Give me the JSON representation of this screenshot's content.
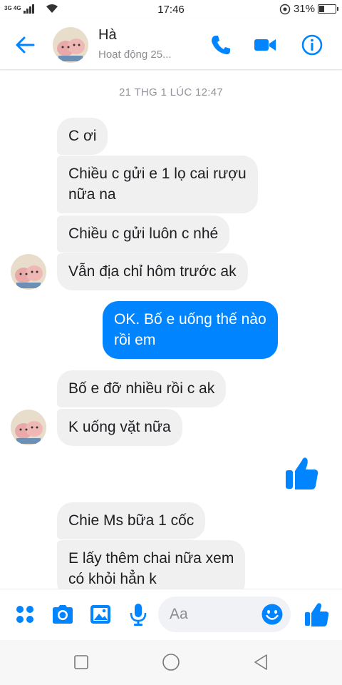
{
  "status_bar": {
    "network": "3G 4G",
    "time": "17:46",
    "battery": "31%",
    "battery_level": 0.31
  },
  "header": {
    "name": "Hà",
    "status": "Hoạt động 25...",
    "icons": [
      "back-arrow-icon",
      "phone-icon",
      "video-call-icon",
      "info-icon"
    ]
  },
  "chat": {
    "timestamp": "21 THG 1 LÚC 12:47",
    "messages": [
      {
        "from": "contact",
        "lines": [
          "C ơi"
        ]
      },
      {
        "from": "contact",
        "lines": [
          "Chiều c gửi e 1 lọ cai rượu",
          "nữa na"
        ]
      },
      {
        "from": "contact",
        "lines": [
          "Chiều c gửi luôn c nhé"
        ]
      },
      {
        "from": "contact",
        "lines": [
          "Vẫn địa chỉ hôm trước ak"
        ]
      },
      {
        "from": "me",
        "lines": [
          "OK. Bố e uống thế nào",
          "rồi em"
        ]
      },
      {
        "from": "contact",
        "lines": [
          "Bố e đỡ nhiều rồi c ak"
        ]
      },
      {
        "from": "contact",
        "lines": [
          "K uống vặt nữa"
        ]
      },
      {
        "from": "me",
        "icon": "thumbs-up-icon"
      },
      {
        "from": "contact",
        "lines": [
          "Chie Ms bữa 1 cốc"
        ]
      },
      {
        "from": "contact",
        "lines": [
          "E lấy thêm chai nữa xem",
          "có khỏi hẳn k"
        ]
      }
    ]
  },
  "composer": {
    "placeholder": "Aa",
    "icons": [
      "more-apps-icon",
      "camera-icon",
      "gallery-icon",
      "microphone-icon",
      "emoji-icon",
      "thumbs-up-icon"
    ]
  },
  "colors": {
    "accent": "#0084ff",
    "incoming_bubble": "#f1f0f0",
    "outgoing_bubble": "#0084ff"
  }
}
